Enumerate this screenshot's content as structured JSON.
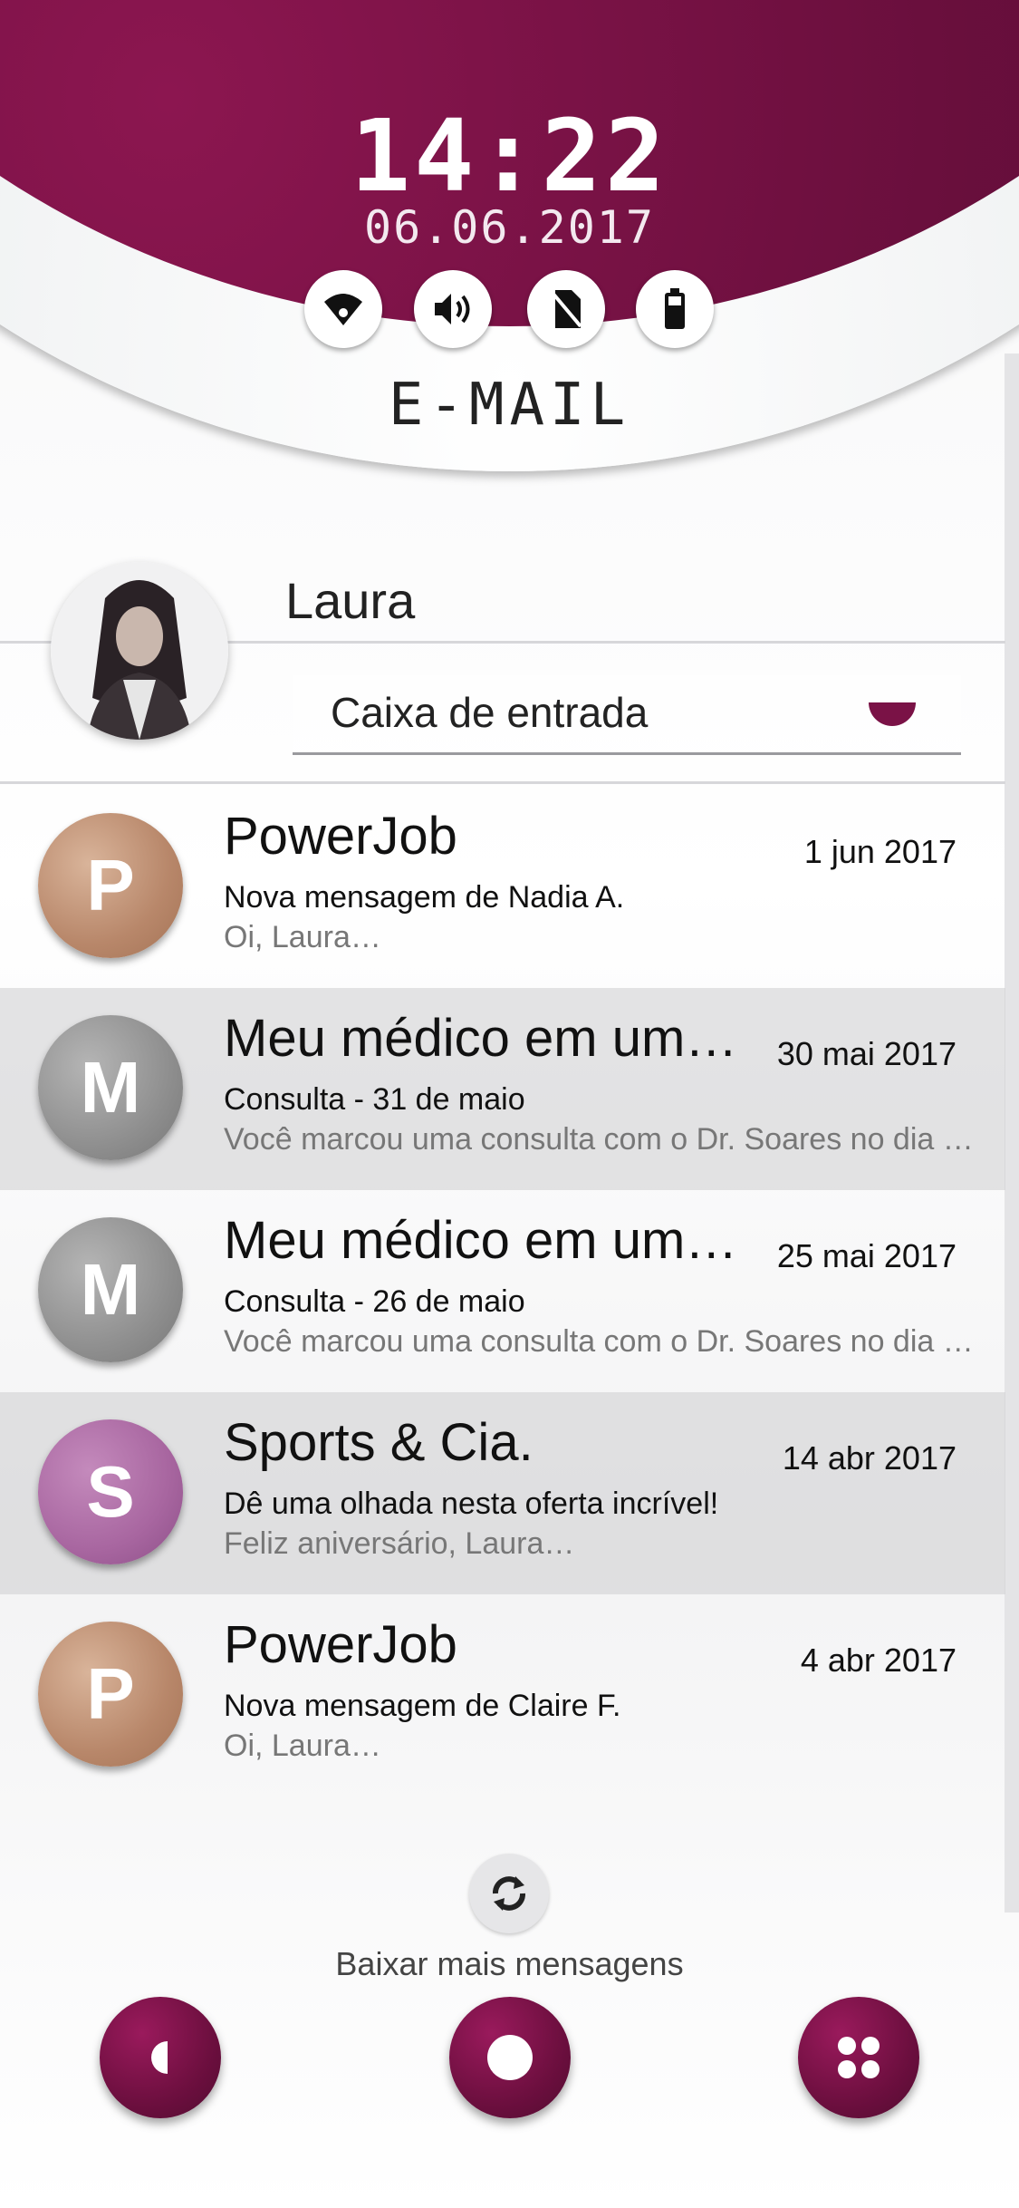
{
  "status": {
    "time": "14:22",
    "date": "06.06.2017",
    "icons": [
      "wifi-icon",
      "volume-icon",
      "no-sim-icon",
      "battery-icon"
    ]
  },
  "app": {
    "title": "E-MAIL"
  },
  "account": {
    "name": "Laura",
    "folder": "Caixa de entrada"
  },
  "messages": [
    {
      "initial": "P",
      "sender": "PowerJob",
      "date": "1 jun 2017",
      "subject": "Nova mensagem de Nadia A.",
      "preview": "Oi, Laura…"
    },
    {
      "initial": "M",
      "sender": "Meu médico em um…",
      "date": "30 mai 2017",
      "subject": "Consulta - 31 de maio",
      "preview": "Você marcou uma consulta com o Dr. Soares no dia …"
    },
    {
      "initial": "M",
      "sender": "Meu médico em um…",
      "date": "25 mai 2017",
      "subject": "Consulta - 26 de maio",
      "preview": "Você marcou uma consulta com o Dr. Soares no dia …"
    },
    {
      "initial": "S",
      "sender": "Sports & Cia.",
      "date": "14 abr 2017",
      "subject": "Dê uma olhada nesta oferta incrível!",
      "preview": "Feliz aniversário, Laura…"
    },
    {
      "initial": "P",
      "sender": "PowerJob",
      "date": "4 abr 2017",
      "subject": "Nova mensagem de Claire F.",
      "preview": "Oi, Laura…"
    }
  ],
  "load_more": "Baixar mais mensagens",
  "colors": {
    "accent": "#6d0f3f",
    "silver": "#e8eaec"
  }
}
